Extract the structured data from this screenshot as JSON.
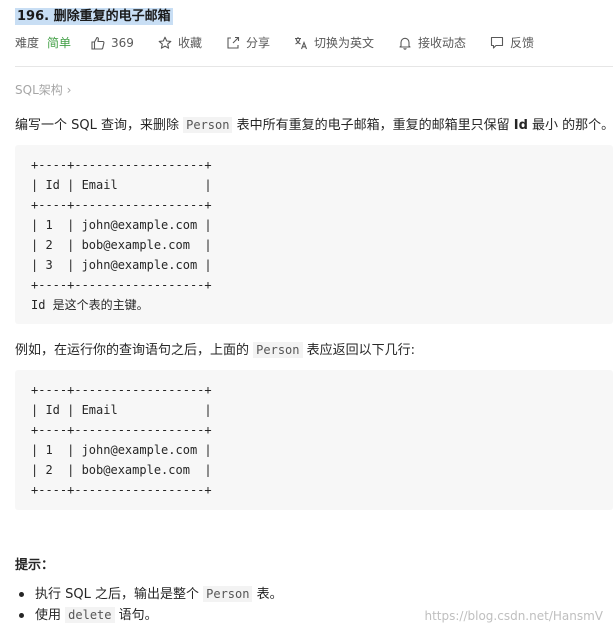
{
  "problem": {
    "title": "196. 删除重复的电子邮箱",
    "difficulty_label": "难度",
    "difficulty_value": "简单",
    "likes": "369",
    "favorite_label": "收藏",
    "share_label": "分享",
    "switch_lang_label": "切换为英文",
    "notifications_label": "接收动态",
    "feedback_label": "反馈",
    "accent_color": "#43a047"
  },
  "breadcrumb": {
    "label": "SQL架构 ›"
  },
  "description": {
    "prefix": "编写一个 SQL 查询，来删除 ",
    "code": "Person",
    "middle": " 表中所有重复的电子邮箱，重复的邮箱里只保留 ",
    "bold": "Id",
    "suffix": " 最小 的那个。"
  },
  "table1": {
    "lines": [
      "+----+------------------+",
      "| Id | Email            |",
      "+----+------------------+",
      "| 1  | john@example.com |",
      "| 2  | bob@example.com  |",
      "| 3  | john@example.com |",
      "+----+------------------+",
      "Id 是这个表的主键。"
    ]
  },
  "example": {
    "prefix": "例如，在运行你的查询语句之后，上面的 ",
    "code": "Person",
    "suffix": " 表应返回以下几行:"
  },
  "table2": {
    "lines": [
      "+----+------------------+",
      "| Id | Email            |",
      "+----+------------------+",
      "| 1  | john@example.com |",
      "| 2  | bob@example.com  |",
      "+----+------------------+"
    ]
  },
  "hints": {
    "title": "提示：",
    "item1_prefix": "执行 SQL 之后，输出是整个 ",
    "item1_code": "Person",
    "item1_suffix": " 表。",
    "item2_prefix": "使用 ",
    "item2_code": "delete",
    "item2_suffix": " 语句。"
  },
  "watermark": "https://blog.csdn.net/HansmV"
}
